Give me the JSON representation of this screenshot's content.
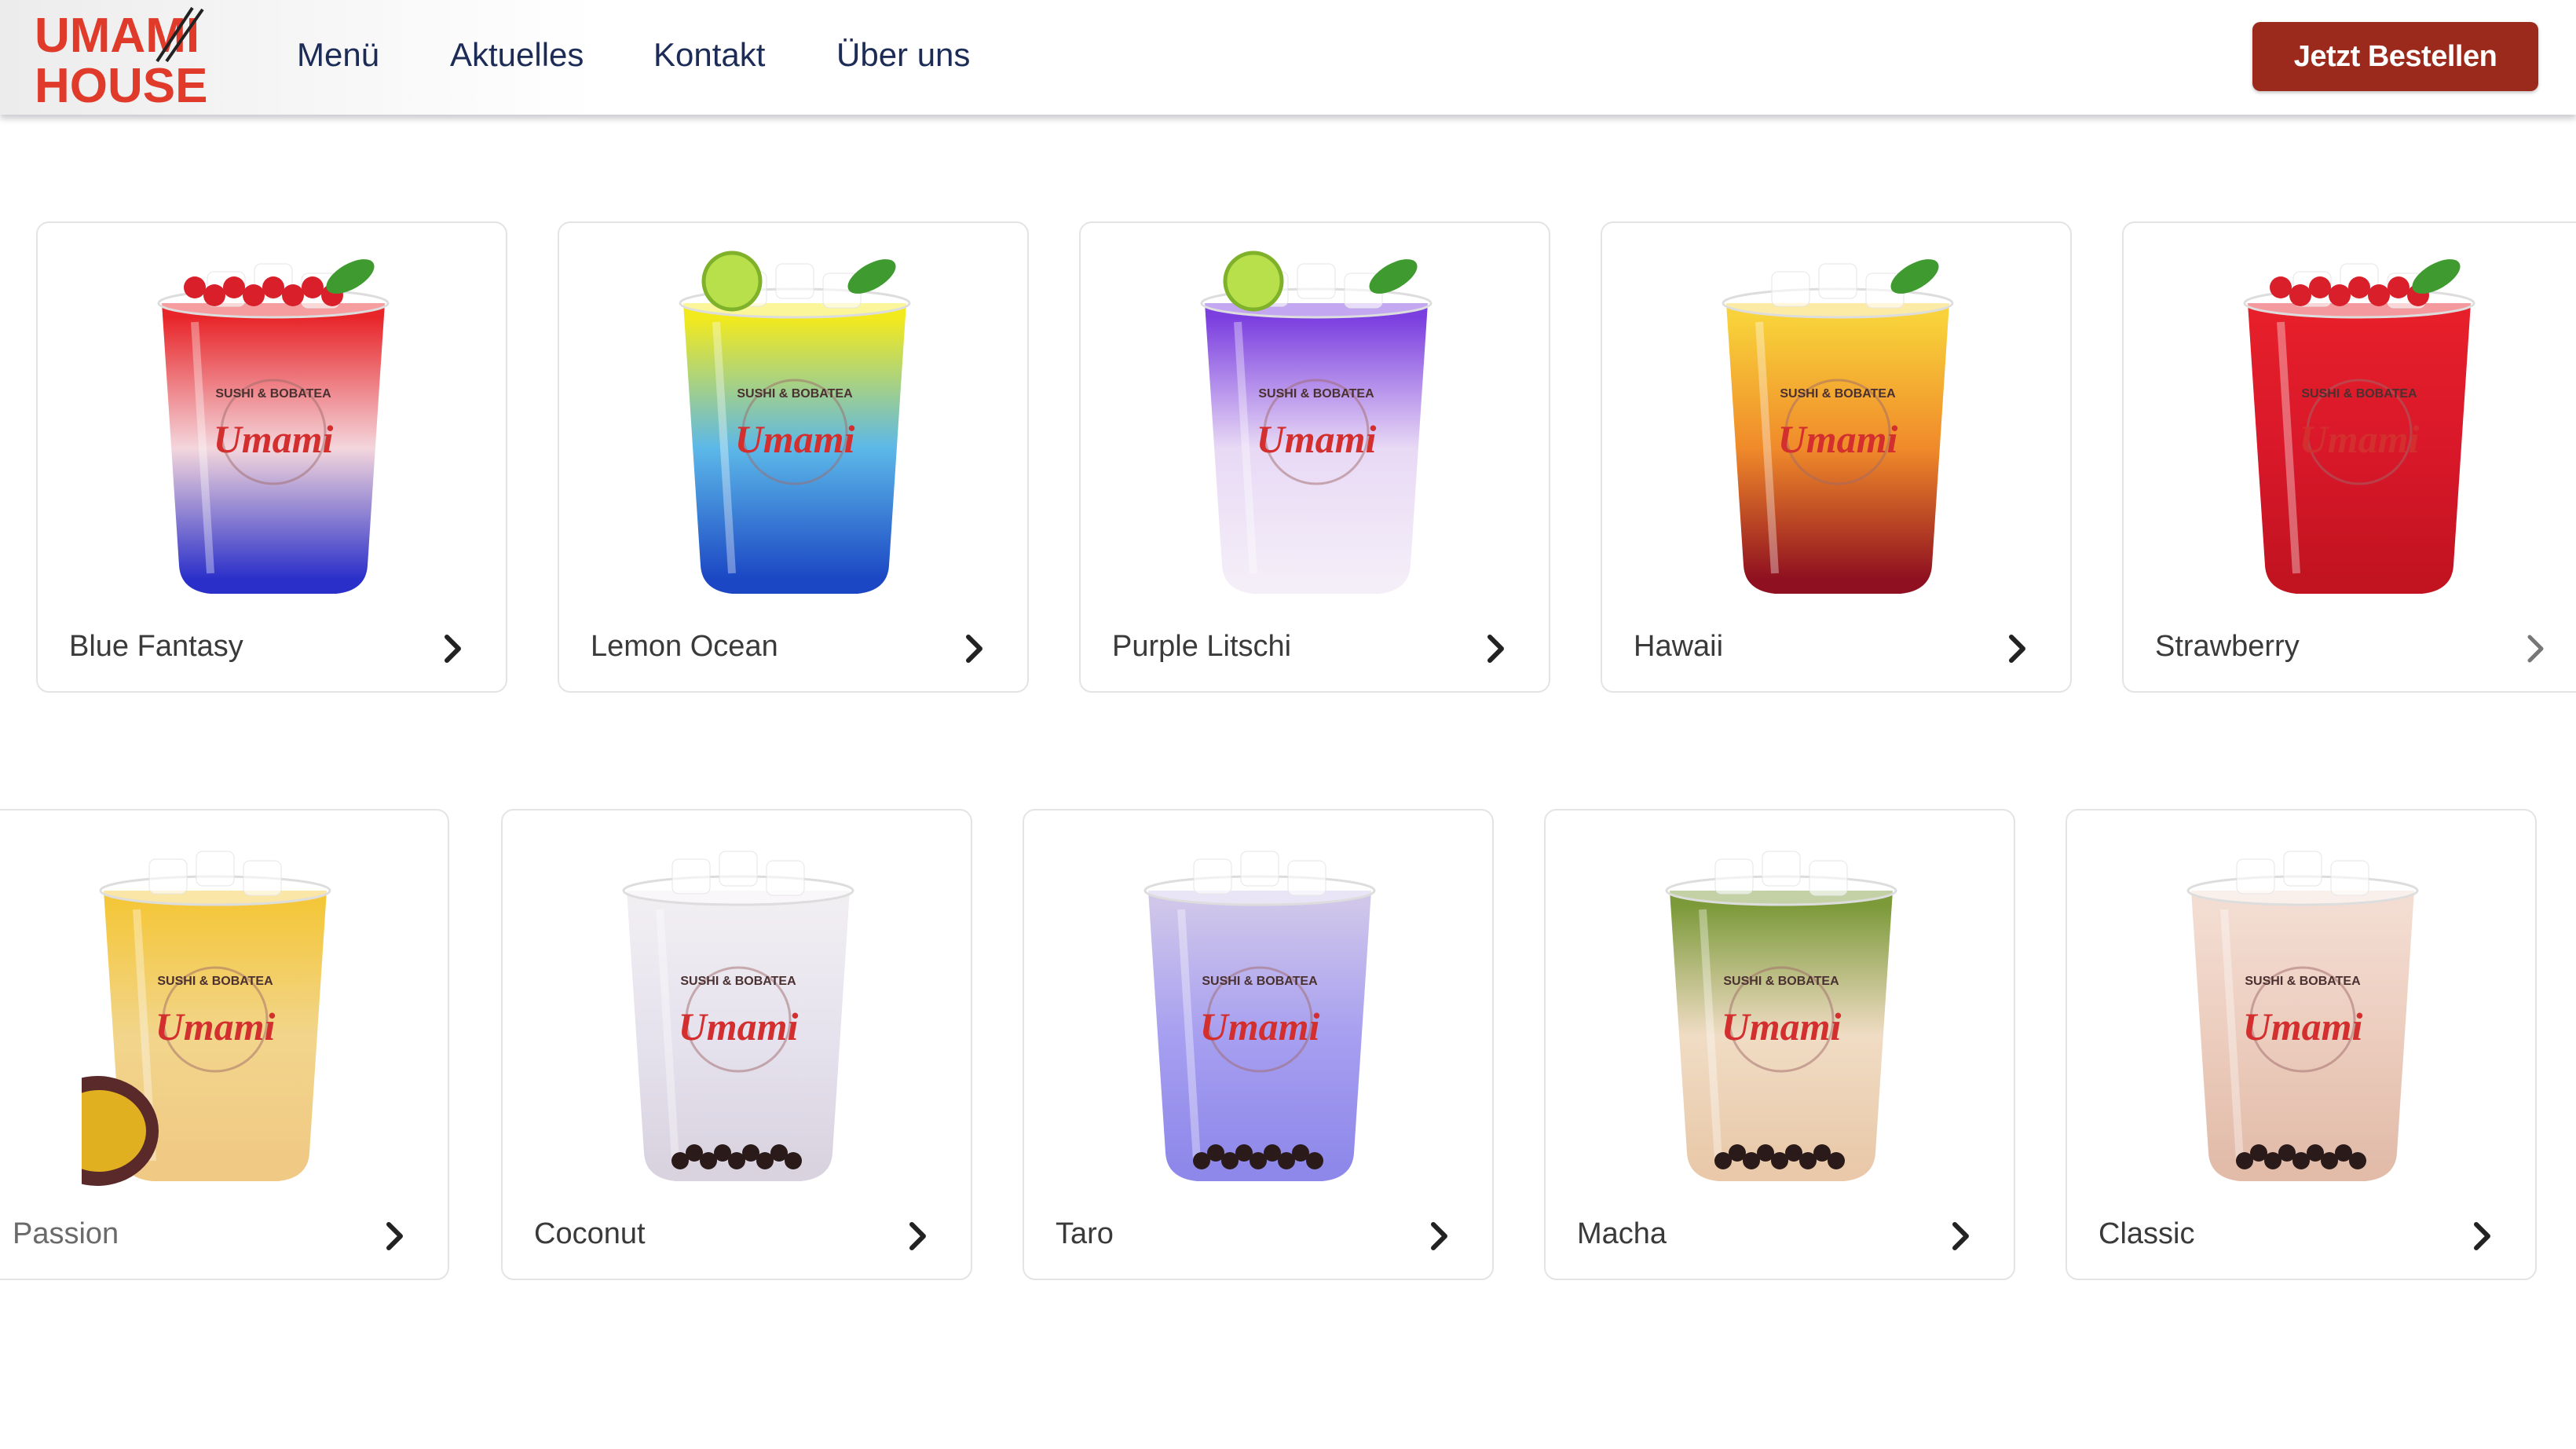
{
  "header": {
    "logo": {
      "line1": "UMAMI",
      "line2": "HOUSE",
      "color": "#e03a2b"
    },
    "nav": [
      {
        "label": "Menü"
      },
      {
        "label": "Aktuelles"
      },
      {
        "label": "Kontakt"
      },
      {
        "label": "Über uns"
      }
    ],
    "cta_label": "Jetzt Bestellen",
    "colors": {
      "nav_text": "#1c2c57",
      "cta_bg": "#9b2a1c"
    }
  },
  "cup_branding": {
    "brand": "Umami",
    "tagline": "SUSHI & BOBATEA"
  },
  "drinks_row1": [
    {
      "name": "Blue Fantasy",
      "top": "#e8262a",
      "mid": "#f3d6dc",
      "bottom": "#2a2fc9",
      "garnish": "berries"
    },
    {
      "name": "Lemon Ocean",
      "top": "#f3ea1d",
      "mid": "#5cb8e8",
      "bottom": "#1b47c4",
      "garnish": "lime"
    },
    {
      "name": "Purple Litschi",
      "top": "#7b3fe0",
      "mid": "#e8d9f5",
      "bottom": "#f4eef8",
      "garnish": "lime"
    },
    {
      "name": "Hawaii",
      "top": "#f8d23a",
      "mid": "#f08a2a",
      "bottom": "#8f1020",
      "garnish": "mint"
    },
    {
      "name": "Strawberry",
      "top": "#e61f2a",
      "mid": "#d9182a",
      "bottom": "#c21320",
      "garnish": "berries"
    }
  ],
  "drinks_row2": [
    {
      "name": "Passion",
      "top": "#f4c73b",
      "mid": "#f2d58b",
      "bottom": "#f0c984",
      "garnish": "passionfruit"
    },
    {
      "name": "Coconut",
      "top": "#f1eef2",
      "mid": "#e6e2ee",
      "bottom": "#d9d3e0",
      "garnish": "pearls"
    },
    {
      "name": "Taro",
      "top": "#cfc6ea",
      "mid": "#a79ff0",
      "bottom": "#8e88ea",
      "garnish": "pearls"
    },
    {
      "name": "Macha",
      "top": "#7c9a3a",
      "mid": "#f0dcc4",
      "bottom": "#e9c9a9",
      "garnish": "pearls"
    },
    {
      "name": "Classic",
      "top": "#f3ddd2",
      "mid": "#eccdbe",
      "bottom": "#e2bba9",
      "garnish": "pearls"
    }
  ]
}
